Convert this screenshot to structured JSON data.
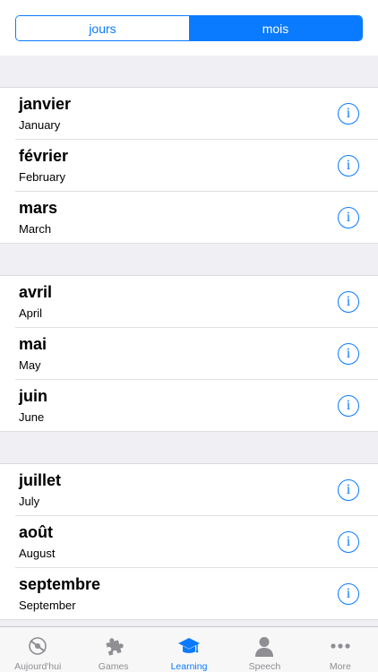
{
  "segmented": {
    "options": [
      "jours",
      "mois"
    ],
    "selected": "mois"
  },
  "sections": [
    {
      "rows": [
        {
          "fr": "janvier",
          "en": "January"
        },
        {
          "fr": "février",
          "en": "February"
        },
        {
          "fr": "mars",
          "en": "March"
        }
      ]
    },
    {
      "rows": [
        {
          "fr": "avril",
          "en": "April"
        },
        {
          "fr": "mai",
          "en": "May"
        },
        {
          "fr": "juin",
          "en": "June"
        }
      ]
    },
    {
      "rows": [
        {
          "fr": "juillet",
          "en": "July"
        },
        {
          "fr": "août",
          "en": "August"
        },
        {
          "fr": "septembre",
          "en": "September"
        }
      ]
    }
  ],
  "info_glyph": "i",
  "tabbar": {
    "items": [
      {
        "label": "Aujourd'hui",
        "icon": "today-icon"
      },
      {
        "label": "Games",
        "icon": "puzzle-icon"
      },
      {
        "label": "Learning",
        "icon": "graduation-cap-icon"
      },
      {
        "label": "Speech",
        "icon": "person-icon"
      },
      {
        "label": "More",
        "icon": "more-dots-icon"
      }
    ],
    "active": "Learning"
  },
  "colors": {
    "accent": "#0a7aff",
    "section_bg": "#efeff4",
    "inactive": "#8e8e93"
  }
}
